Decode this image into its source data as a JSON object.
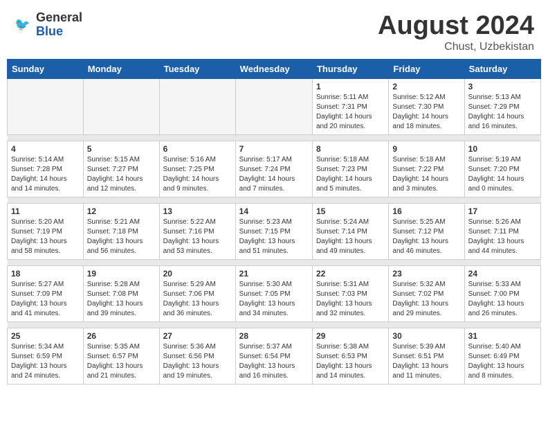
{
  "header": {
    "logo_general": "General",
    "logo_blue": "Blue",
    "main_title": "August 2024",
    "subtitle": "Chust, Uzbekistan"
  },
  "weekdays": [
    "Sunday",
    "Monday",
    "Tuesday",
    "Wednesday",
    "Thursday",
    "Friday",
    "Saturday"
  ],
  "weeks": [
    [
      {
        "day": "",
        "info": "",
        "empty": true
      },
      {
        "day": "",
        "info": "",
        "empty": true
      },
      {
        "day": "",
        "info": "",
        "empty": true
      },
      {
        "day": "",
        "info": "",
        "empty": true
      },
      {
        "day": "1",
        "info": "Sunrise: 5:11 AM\nSunset: 7:31 PM\nDaylight: 14 hours\nand 20 minutes."
      },
      {
        "day": "2",
        "info": "Sunrise: 5:12 AM\nSunset: 7:30 PM\nDaylight: 14 hours\nand 18 minutes."
      },
      {
        "day": "3",
        "info": "Sunrise: 5:13 AM\nSunset: 7:29 PM\nDaylight: 14 hours\nand 16 minutes."
      }
    ],
    [
      {
        "day": "4",
        "info": "Sunrise: 5:14 AM\nSunset: 7:28 PM\nDaylight: 14 hours\nand 14 minutes."
      },
      {
        "day": "5",
        "info": "Sunrise: 5:15 AM\nSunset: 7:27 PM\nDaylight: 14 hours\nand 12 minutes."
      },
      {
        "day": "6",
        "info": "Sunrise: 5:16 AM\nSunset: 7:25 PM\nDaylight: 14 hours\nand 9 minutes."
      },
      {
        "day": "7",
        "info": "Sunrise: 5:17 AM\nSunset: 7:24 PM\nDaylight: 14 hours\nand 7 minutes."
      },
      {
        "day": "8",
        "info": "Sunrise: 5:18 AM\nSunset: 7:23 PM\nDaylight: 14 hours\nand 5 minutes."
      },
      {
        "day": "9",
        "info": "Sunrise: 5:18 AM\nSunset: 7:22 PM\nDaylight: 14 hours\nand 3 minutes."
      },
      {
        "day": "10",
        "info": "Sunrise: 5:19 AM\nSunset: 7:20 PM\nDaylight: 14 hours\nand 0 minutes."
      }
    ],
    [
      {
        "day": "11",
        "info": "Sunrise: 5:20 AM\nSunset: 7:19 PM\nDaylight: 13 hours\nand 58 minutes."
      },
      {
        "day": "12",
        "info": "Sunrise: 5:21 AM\nSunset: 7:18 PM\nDaylight: 13 hours\nand 56 minutes."
      },
      {
        "day": "13",
        "info": "Sunrise: 5:22 AM\nSunset: 7:16 PM\nDaylight: 13 hours\nand 53 minutes."
      },
      {
        "day": "14",
        "info": "Sunrise: 5:23 AM\nSunset: 7:15 PM\nDaylight: 13 hours\nand 51 minutes."
      },
      {
        "day": "15",
        "info": "Sunrise: 5:24 AM\nSunset: 7:14 PM\nDaylight: 13 hours\nand 49 minutes."
      },
      {
        "day": "16",
        "info": "Sunrise: 5:25 AM\nSunset: 7:12 PM\nDaylight: 13 hours\nand 46 minutes."
      },
      {
        "day": "17",
        "info": "Sunrise: 5:26 AM\nSunset: 7:11 PM\nDaylight: 13 hours\nand 44 minutes."
      }
    ],
    [
      {
        "day": "18",
        "info": "Sunrise: 5:27 AM\nSunset: 7:09 PM\nDaylight: 13 hours\nand 41 minutes."
      },
      {
        "day": "19",
        "info": "Sunrise: 5:28 AM\nSunset: 7:08 PM\nDaylight: 13 hours\nand 39 minutes."
      },
      {
        "day": "20",
        "info": "Sunrise: 5:29 AM\nSunset: 7:06 PM\nDaylight: 13 hours\nand 36 minutes."
      },
      {
        "day": "21",
        "info": "Sunrise: 5:30 AM\nSunset: 7:05 PM\nDaylight: 13 hours\nand 34 minutes."
      },
      {
        "day": "22",
        "info": "Sunrise: 5:31 AM\nSunset: 7:03 PM\nDaylight: 13 hours\nand 32 minutes."
      },
      {
        "day": "23",
        "info": "Sunrise: 5:32 AM\nSunset: 7:02 PM\nDaylight: 13 hours\nand 29 minutes."
      },
      {
        "day": "24",
        "info": "Sunrise: 5:33 AM\nSunset: 7:00 PM\nDaylight: 13 hours\nand 26 minutes."
      }
    ],
    [
      {
        "day": "25",
        "info": "Sunrise: 5:34 AM\nSunset: 6:59 PM\nDaylight: 13 hours\nand 24 minutes."
      },
      {
        "day": "26",
        "info": "Sunrise: 5:35 AM\nSunset: 6:57 PM\nDaylight: 13 hours\nand 21 minutes."
      },
      {
        "day": "27",
        "info": "Sunrise: 5:36 AM\nSunset: 6:56 PM\nDaylight: 13 hours\nand 19 minutes."
      },
      {
        "day": "28",
        "info": "Sunrise: 5:37 AM\nSunset: 6:54 PM\nDaylight: 13 hours\nand 16 minutes."
      },
      {
        "day": "29",
        "info": "Sunrise: 5:38 AM\nSunset: 6:53 PM\nDaylight: 13 hours\nand 14 minutes."
      },
      {
        "day": "30",
        "info": "Sunrise: 5:39 AM\nSunset: 6:51 PM\nDaylight: 13 hours\nand 11 minutes."
      },
      {
        "day": "31",
        "info": "Sunrise: 5:40 AM\nSunset: 6:49 PM\nDaylight: 13 hours\nand 8 minutes."
      }
    ]
  ]
}
